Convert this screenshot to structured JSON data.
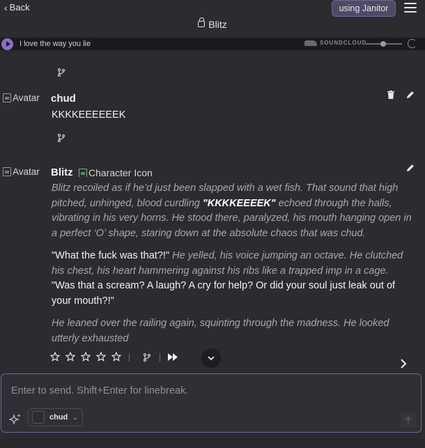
{
  "header": {
    "back_label": "Back",
    "using_label": "using Janitor",
    "title": "Blitz"
  },
  "player": {
    "track_title": "I love the way you lie",
    "brand": "SOUNDCLOUD",
    "accent": "#8f6bc7",
    "volume_fraction": 0.4
  },
  "messages": [
    {
      "avatar_alt": "Avatar",
      "author": "chud",
      "text": "KKKKEEEEEEK"
    },
    {
      "avatar_alt": "Avatar",
      "author": "Blitz",
      "character_icon_alt": "Character Icon",
      "p1_a": "Blitz recoiled as if he’d just been slapped with a wet fish. That sound that high pitched, unhinged, blood curdling ",
      "p1_b": "\"KKKKEEEEK\"",
      "p1_c": " echoed through the halls, vibrating in his very horns. He stood there, paralyzed, his mouth hanging open in a perfect ‘O’ shape, staring down at the absolute chaos that was chud.",
      "p2_a": "\"What the fuck was that?!\"",
      "p2_b": " He yelled, his voice jumping an octave. He clutched his chest, his heart hammering against his ribs like a trapped imp in a cage. ",
      "p2_c": "\"Was that a scream? A laugh? A cry for help? Or did your soul just leak out of your mouth?!\"",
      "p3": "He leaned over the railing again, squinting through the madness. He looked utterly exhausted",
      "rating_stars": 0
    }
  ],
  "composer": {
    "placeholder": "Enter to send. Shift+Enter for linebreak.",
    "persona_name": "chud"
  },
  "colors": {
    "background": "#2b2b30",
    "composer_border": "#6c6892"
  }
}
